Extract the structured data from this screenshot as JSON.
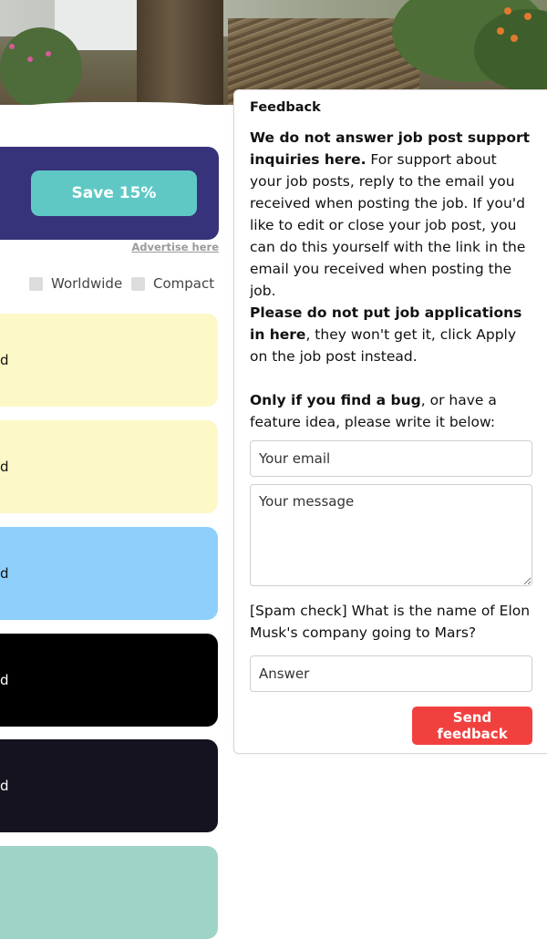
{
  "promo": {
    "save_label": "Save 15%",
    "advertise_label": "Advertise here"
  },
  "filters": [
    {
      "label": "Worldwide",
      "checked": false
    },
    {
      "label": "Compact",
      "checked": false
    }
  ],
  "jobs": [
    {
      "fragment": "d",
      "bg": "#fdf8c7",
      "color": "#111111"
    },
    {
      "fragment": "d",
      "bg": "#fdf8c7",
      "color": "#111111"
    },
    {
      "fragment": "d",
      "bg": "#8ecffb",
      "color": "#111111"
    },
    {
      "fragment": "d",
      "bg": "#000000",
      "color": "#ffffff"
    },
    {
      "fragment": "d",
      "bg": "#15131f",
      "color": "#ffffff"
    },
    {
      "fragment": "",
      "bg": "#9fd3c7",
      "color": "#111111"
    }
  ],
  "feedback": {
    "title": "Feedback",
    "p1_bold": "We do not answer job post support inquiries here.",
    "p1_rest": " For support about your job posts, reply to the email you received when posting the job. If you'd like to edit or close your job post, you can do this yourself with the link in the email you received when posting the job.",
    "p2_bold": "Please do not put job applications in here",
    "p2_rest": ", they won't get it, click Apply on the job post instead.",
    "p3_bold": "Only if you find a bug",
    "p3_rest": ", or have a feature idea, please write it below:",
    "email_placeholder": "Your email",
    "message_placeholder": "Your message",
    "spam_question": "[Spam check] What is the name of Elon Musk's company going to Mars?",
    "answer_placeholder": "Answer",
    "send_label": "Send feedback"
  },
  "colors": {
    "promo_bg": "#37337a",
    "save_button": "#5fc8c5",
    "send_button": "#f1413f"
  }
}
